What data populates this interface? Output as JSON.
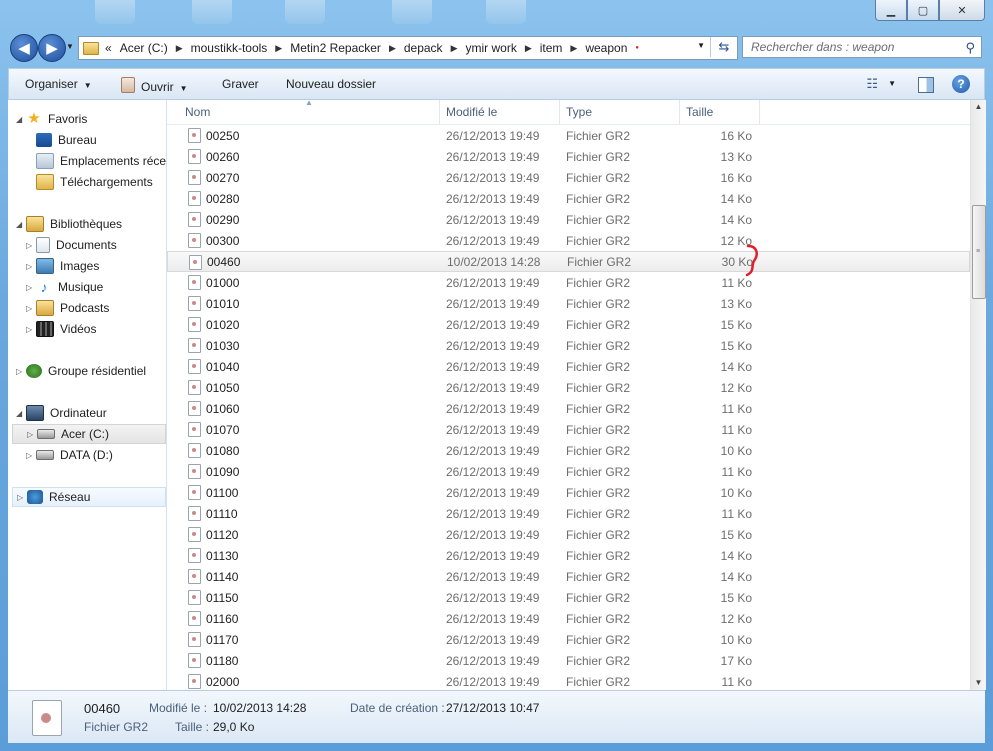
{
  "window": {
    "controls": {
      "minimize": "▁",
      "maximize": "▢",
      "close": "✕"
    }
  },
  "nav": {
    "back": "◀",
    "forward": "▶",
    "overflow": "«",
    "breadcrumb": [
      "Acer (C:)",
      "moustikk-tools",
      "Metin2 Repacker",
      "depack",
      "ymir work",
      "item",
      "weapon"
    ],
    "search_placeholder": "Rechercher dans : weapon"
  },
  "toolbar": {
    "organize": "Organiser",
    "open": "Ouvrir",
    "burn": "Graver",
    "new_folder": "Nouveau dossier",
    "help": "?"
  },
  "sidebar": {
    "favorites": "Favoris",
    "desktop": "Bureau",
    "recent_places": "Emplacements récents",
    "downloads": "Téléchargements",
    "libraries": "Bibliothèques",
    "documents": "Documents",
    "images": "Images",
    "music": "Musique",
    "podcasts": "Podcasts",
    "videos": "Vidéos",
    "homegroup": "Groupe résidentiel",
    "computer": "Ordinateur",
    "drive_c": "Acer (C:)",
    "drive_d": "DATA (D:)",
    "network": "Réseau"
  },
  "columns": {
    "name": "Nom",
    "modified": "Modifié le",
    "type": "Type",
    "size": "Taille"
  },
  "files": [
    {
      "name": "00250",
      "date": "26/12/2013 19:49",
      "type": "Fichier GR2",
      "size": "16 Ko"
    },
    {
      "name": "00260",
      "date": "26/12/2013 19:49",
      "type": "Fichier GR2",
      "size": "13 Ko"
    },
    {
      "name": "00270",
      "date": "26/12/2013 19:49",
      "type": "Fichier GR2",
      "size": "16 Ko"
    },
    {
      "name": "00280",
      "date": "26/12/2013 19:49",
      "type": "Fichier GR2",
      "size": "14 Ko"
    },
    {
      "name": "00290",
      "date": "26/12/2013 19:49",
      "type": "Fichier GR2",
      "size": "14 Ko"
    },
    {
      "name": "00300",
      "date": "26/12/2013 19:49",
      "type": "Fichier GR2",
      "size": "12 Ko"
    },
    {
      "name": "00460",
      "date": "10/02/2013 14:28",
      "type": "Fichier GR2",
      "size": "30 Ko",
      "selected": true
    },
    {
      "name": "01000",
      "date": "26/12/2013 19:49",
      "type": "Fichier GR2",
      "size": "11 Ko"
    },
    {
      "name": "01010",
      "date": "26/12/2013 19:49",
      "type": "Fichier GR2",
      "size": "13 Ko"
    },
    {
      "name": "01020",
      "date": "26/12/2013 19:49",
      "type": "Fichier GR2",
      "size": "15 Ko"
    },
    {
      "name": "01030",
      "date": "26/12/2013 19:49",
      "type": "Fichier GR2",
      "size": "15 Ko"
    },
    {
      "name": "01040",
      "date": "26/12/2013 19:49",
      "type": "Fichier GR2",
      "size": "14 Ko"
    },
    {
      "name": "01050",
      "date": "26/12/2013 19:49",
      "type": "Fichier GR2",
      "size": "12 Ko"
    },
    {
      "name": "01060",
      "date": "26/12/2013 19:49",
      "type": "Fichier GR2",
      "size": "11 Ko"
    },
    {
      "name": "01070",
      "date": "26/12/2013 19:49",
      "type": "Fichier GR2",
      "size": "11 Ko"
    },
    {
      "name": "01080",
      "date": "26/12/2013 19:49",
      "type": "Fichier GR2",
      "size": "10 Ko"
    },
    {
      "name": "01090",
      "date": "26/12/2013 19:49",
      "type": "Fichier GR2",
      "size": "11 Ko"
    },
    {
      "name": "01100",
      "date": "26/12/2013 19:49",
      "type": "Fichier GR2",
      "size": "10 Ko"
    },
    {
      "name": "01110",
      "date": "26/12/2013 19:49",
      "type": "Fichier GR2",
      "size": "11 Ko"
    },
    {
      "name": "01120",
      "date": "26/12/2013 19:49",
      "type": "Fichier GR2",
      "size": "15 Ko"
    },
    {
      "name": "01130",
      "date": "26/12/2013 19:49",
      "type": "Fichier GR2",
      "size": "14 Ko"
    },
    {
      "name": "01140",
      "date": "26/12/2013 19:49",
      "type": "Fichier GR2",
      "size": "14 Ko"
    },
    {
      "name": "01150",
      "date": "26/12/2013 19:49",
      "type": "Fichier GR2",
      "size": "15 Ko"
    },
    {
      "name": "01160",
      "date": "26/12/2013 19:49",
      "type": "Fichier GR2",
      "size": "12 Ko"
    },
    {
      "name": "01170",
      "date": "26/12/2013 19:49",
      "type": "Fichier GR2",
      "size": "10 Ko"
    },
    {
      "name": "01180",
      "date": "26/12/2013 19:49",
      "type": "Fichier GR2",
      "size": "17 Ko"
    },
    {
      "name": "02000",
      "date": "26/12/2013 19:49",
      "type": "Fichier GR2",
      "size": "11 Ko"
    }
  ],
  "details": {
    "name": "00460",
    "type": "Fichier GR2",
    "modified_label": "Modifié le :",
    "modified_value": "10/02/2013 14:28",
    "size_label": "Taille :",
    "size_value": "29,0 Ko",
    "created_label": "Date de création :",
    "created_value": "27/12/2013 10:47"
  },
  "colors": {
    "annotation": "#e0202a",
    "accent": "#1d4e9c"
  }
}
